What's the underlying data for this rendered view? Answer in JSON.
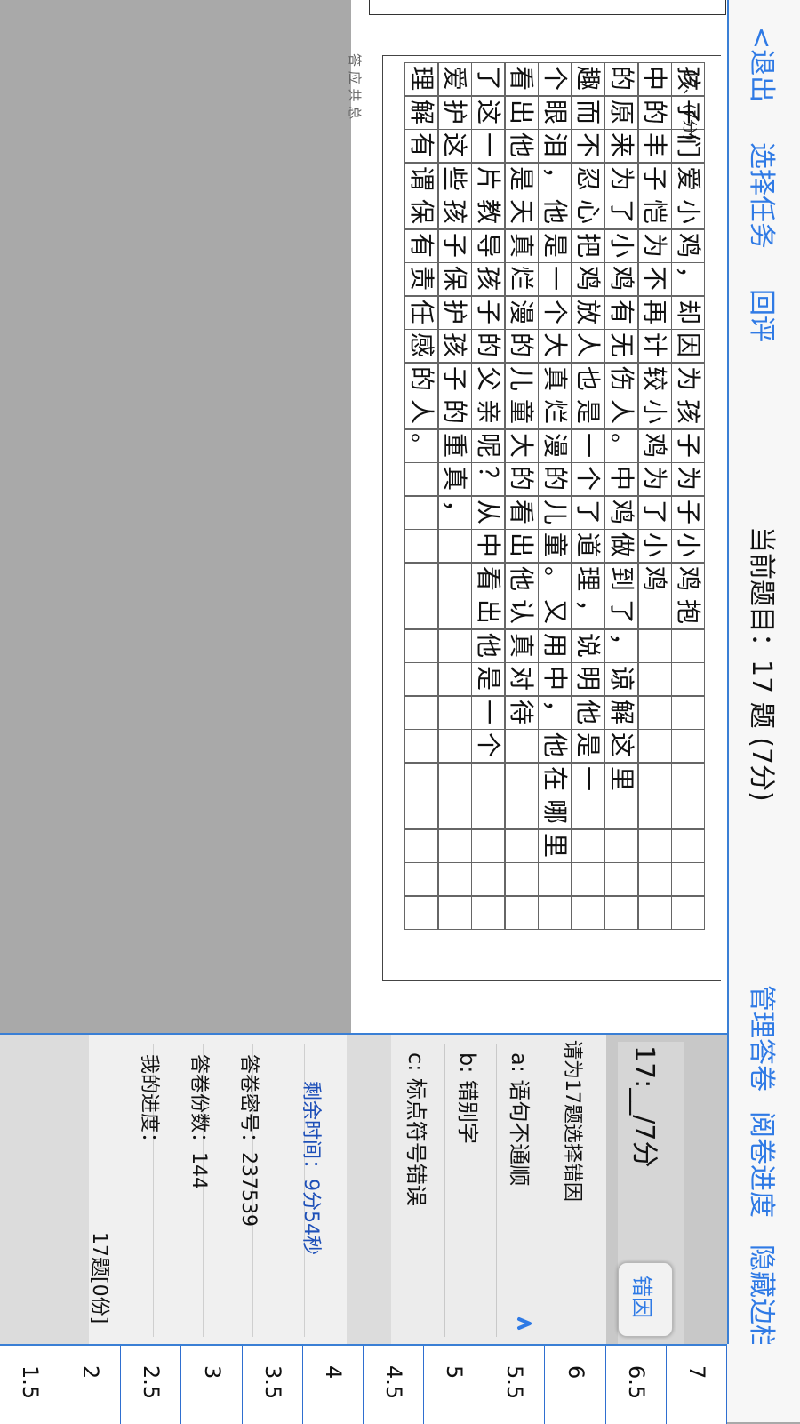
{
  "nav": {
    "exit": "<退出",
    "select_task": "选择任务",
    "review": "回评",
    "current_question": "当前题目：17 题 (7分)",
    "manage_answers": "管理答卷",
    "grading_progress": "阅卷进度",
    "hide_sidebar": "隐藏边栏"
  },
  "scan": {
    "question_label": "17、(7分)",
    "footer_text": "答   应   共   总",
    "handwriting_columns": [
      "孩子们爱小鸡，却因为孩子为子小鸡抱",
      "中的丰子恺为不再计较小鸡为了小鸡",
      "的原来为了小鸡有无伤人。中鸡做到了，谅解这里",
      "趣而不忍心把鸡放人也是一个了道理，说明他是一",
      "个眼泪，他是一个大真烂漫的儿童。又用中，他在哪里",
      "看出他是天真烂漫的儿童大的看出他认真对待",
      "了这一片教导孩子的父亲呢？从中看出他是一个",
      "爱护这些孩子保护孩子的重真，",
      "理解有谓保有责任感的人。"
    ]
  },
  "panel": {
    "score_input": "17:__/7分",
    "reason_button": "错因",
    "prompt": "请为17题选择错因",
    "options": [
      "a: 语句不通顺",
      "b: 错别字",
      "c: 标点符号错误"
    ],
    "remaining_time": "剩余时间：9分54秒",
    "paper_number": "答卷密号：237539",
    "paper_count": "答卷份数：144",
    "my_progress_label": "我的进度：",
    "my_progress_value": "17题[0份]"
  },
  "keys": [
    "7",
    "6.5",
    "6",
    "5.5",
    "5",
    "4.5",
    "4",
    "3.5",
    "3",
    "2.5",
    "2",
    "1.5"
  ],
  "colors": {
    "accent": "#2f7ae5",
    "border_blue": "#3a7fd5",
    "time_text": "#1d4fb8",
    "gray_bg": "#a9a9a9"
  }
}
